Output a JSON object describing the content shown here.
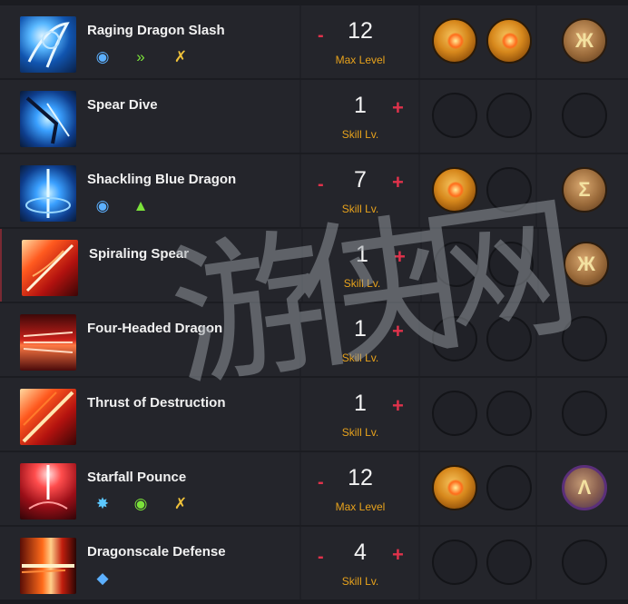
{
  "skills": [
    {
      "name": "Raging Dragon Slash",
      "icon": "dragon-slash-icon",
      "tags": [
        "stagger-icon",
        "push-immune-icon",
        "counter-icon"
      ],
      "minus": "-",
      "level": "12",
      "level_label": "Max Level",
      "plus": "",
      "tripods": [
        "gem",
        "gem"
      ],
      "rune": "rune"
    },
    {
      "name": "Spear Dive",
      "icon": "spear-dive-icon",
      "tags": [],
      "minus": "",
      "level": "1",
      "level_label": "Skill Lv.",
      "plus": "+",
      "tripods": [
        "empty",
        "empty"
      ],
      "rune": "empty"
    },
    {
      "name": "Shackling Blue Dragon",
      "icon": "blue-dragon-icon",
      "tags": [
        "stagger-icon",
        "knockdown-icon"
      ],
      "minus": "-",
      "level": "7",
      "level_label": "Skill Lv.",
      "plus": "+",
      "tripods": [
        "gem",
        "empty"
      ],
      "rune": "rune"
    },
    {
      "name": "Spiraling Spear",
      "icon": "spiraling-spear-icon",
      "tags": [],
      "minus": "",
      "level": "1",
      "level_label": "Skill Lv.",
      "plus": "+",
      "tripods": [
        "empty",
        "empty"
      ],
      "rune": "rune"
    },
    {
      "name": "Four-Headed Dragon",
      "icon": "four-headed-dragon-icon",
      "tags": [],
      "minus": "",
      "level": "1",
      "level_label": "Skill Lv.",
      "plus": "+",
      "tripods": [
        "empty",
        "empty"
      ],
      "rune": "empty"
    },
    {
      "name": "Thrust of Destruction",
      "icon": "thrust-destruction-icon",
      "tags": [],
      "minus": "",
      "level": "1",
      "level_label": "Skill Lv.",
      "plus": "+",
      "tripods": [
        "empty",
        "empty"
      ],
      "rune": "empty"
    },
    {
      "name": "Starfall Pounce",
      "icon": "starfall-pounce-icon",
      "tags": [
        "weak-point-icon",
        "stagger-icon",
        "counter-icon"
      ],
      "minus": "-",
      "level": "12",
      "level_label": "Max Level",
      "plus": "",
      "tripods": [
        "gem",
        "empty"
      ],
      "rune": "rune-purple"
    },
    {
      "name": "Dragonscale Defense",
      "icon": "dragonscale-defense-icon",
      "tags": [
        "shield-icon"
      ],
      "minus": "-",
      "level": "4",
      "level_label": "Skill Lv.",
      "plus": "+",
      "tripods": [
        "empty",
        "empty"
      ],
      "rune": "empty"
    }
  ],
  "colors": {
    "accent_red": "#e0324b",
    "label_gold": "#e7a21c"
  }
}
